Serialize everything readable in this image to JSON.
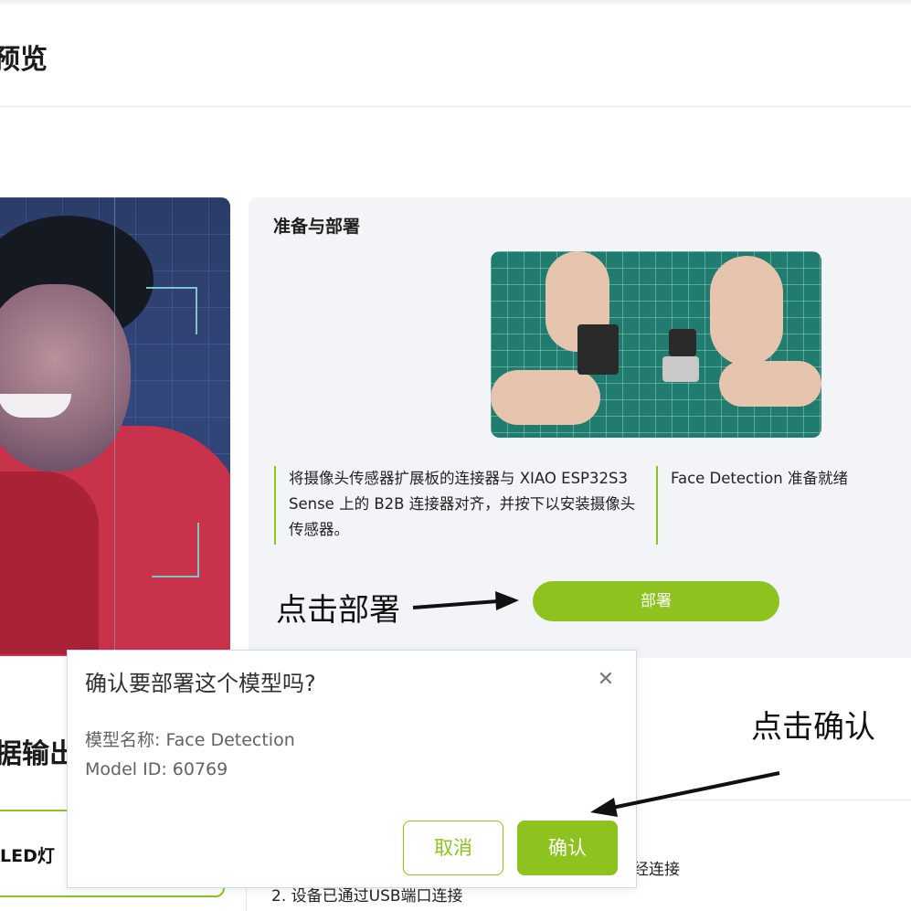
{
  "header": {
    "title": "预览"
  },
  "prepare": {
    "title": "准备与部署",
    "instruction": "将摄像头传感器扩展板的连接器与 XIAO ESP32S3 Sense 上的 B2B 连接器对齐，并按下以安装摄像头传感器。",
    "status": "Face Detection 准备就绪",
    "deploy_label": "部署"
  },
  "annotations": {
    "click_deploy": "点击部署",
    "click_confirm": "点击确认"
  },
  "output": {
    "title": "据输出",
    "led_label": "LED灯",
    "status_line_1": "已经连接",
    "status_line_2": "2. 设备已通过USB端口连接"
  },
  "dialog": {
    "title": "确认要部署这个模型吗?",
    "model_name": "模型名称: Face Detection",
    "model_id": "Model ID: 60769",
    "cancel_label": "取消",
    "confirm_label": "确认",
    "close_icon": "close-icon"
  },
  "colors": {
    "accent": "#8dc21f",
    "card_bg": "#f3f4f7"
  }
}
